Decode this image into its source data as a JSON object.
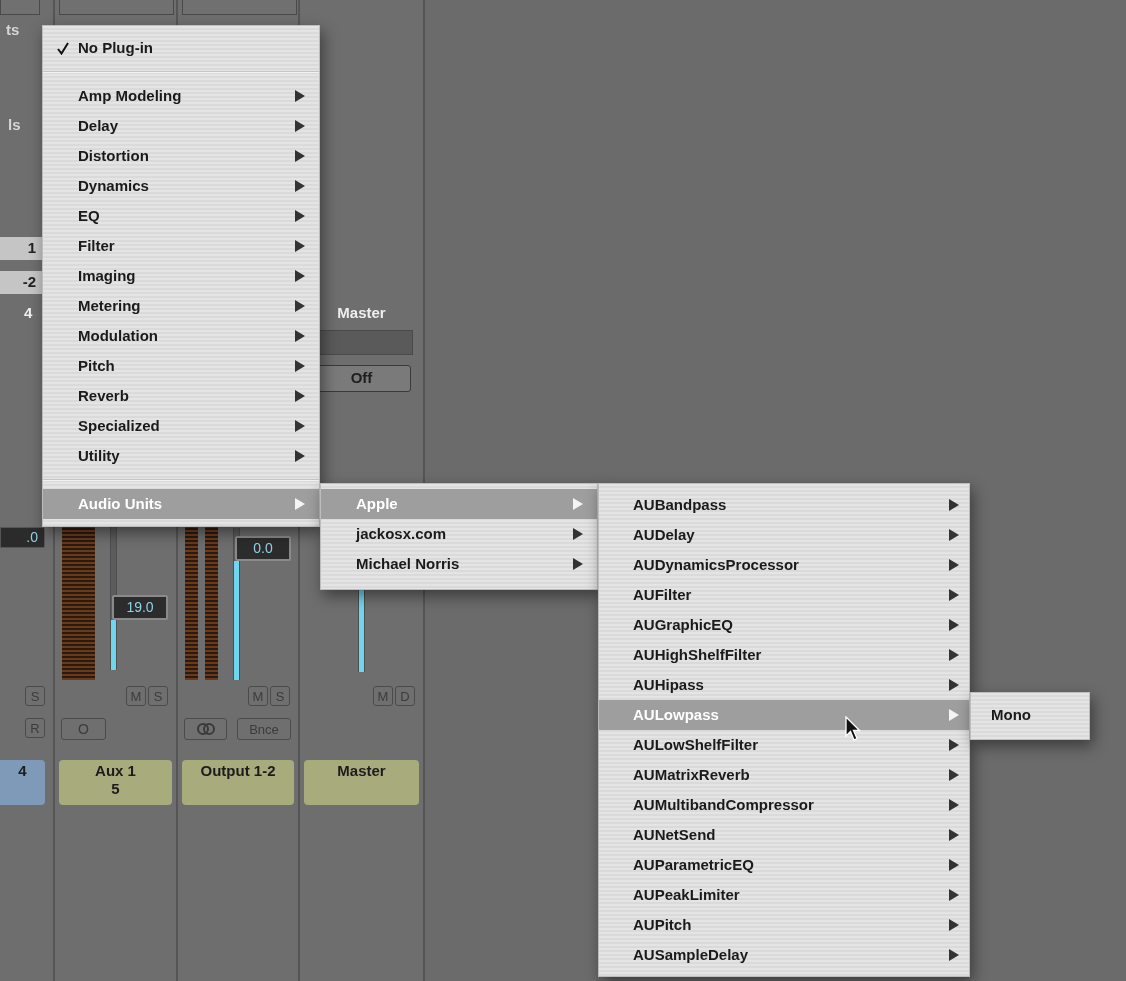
{
  "mixer": {
    "strips": [
      {
        "kind": "cut",
        "inserts_label": "ts",
        "sends_label": "ls",
        "io_buttons": [
          "1",
          "-2"
        ],
        "name": "4",
        "readout": ".0",
        "row_a": [
          {
            "kind": "text",
            "label": "S"
          }
        ],
        "row_b": [
          {
            "kind": "text",
            "label": "R"
          }
        ],
        "label": "4",
        "color": "#7f9ab9"
      },
      {
        "kind": "aux",
        "readout": "19.0",
        "level": 0.33,
        "row_a": [
          {
            "kind": "text",
            "label": "M"
          },
          {
            "kind": "text",
            "label": "S"
          }
        ],
        "row_b": [
          {
            "kind": "text",
            "label": "O"
          }
        ],
        "label": "Aux 1",
        "number": "5",
        "color": "#a8ab7c"
      },
      {
        "kind": "output",
        "readout": "0.0",
        "level": 0.78,
        "row_a": [
          {
            "kind": "text",
            "label": "M"
          },
          {
            "kind": "text",
            "label": "S"
          }
        ],
        "row_b": [
          {
            "kind": "link"
          },
          {
            "kind": "text",
            "label": "Bnce"
          }
        ],
        "label": "Output 1-2",
        "color": "#a8ab7c"
      },
      {
        "kind": "master",
        "name": "Master",
        "mode": "Off",
        "level": 0.95,
        "row_a": [
          {
            "kind": "text",
            "label": "M"
          },
          {
            "kind": "text",
            "label": "D"
          }
        ],
        "label": "Master",
        "color": "#a8ab7c"
      }
    ]
  },
  "menus": [
    {
      "items": [
        {
          "kind": "check",
          "label": "No Plug-in",
          "checked": true
        },
        {
          "kind": "separator"
        },
        {
          "kind": "submenu",
          "label": "Amp Modeling",
          "selected": false
        },
        {
          "kind": "submenu",
          "label": "Delay",
          "selected": false
        },
        {
          "kind": "submenu",
          "label": "Distortion",
          "selected": false
        },
        {
          "kind": "submenu",
          "label": "Dynamics",
          "selected": false
        },
        {
          "kind": "submenu",
          "label": "EQ",
          "selected": false
        },
        {
          "kind": "submenu",
          "label": "Filter",
          "selected": false
        },
        {
          "kind": "submenu",
          "label": "Imaging",
          "selected": false
        },
        {
          "kind": "submenu",
          "label": "Metering",
          "selected": false
        },
        {
          "kind": "submenu",
          "label": "Modulation",
          "selected": false
        },
        {
          "kind": "submenu",
          "label": "Pitch",
          "selected": false
        },
        {
          "kind": "submenu",
          "label": "Reverb",
          "selected": false
        },
        {
          "kind": "submenu",
          "label": "Specialized",
          "selected": false
        },
        {
          "kind": "submenu",
          "label": "Utility",
          "selected": false
        },
        {
          "kind": "separator"
        },
        {
          "kind": "submenu",
          "label": "Audio Units",
          "selected": true
        }
      ]
    },
    {
      "items": [
        {
          "kind": "submenu",
          "label": "Apple",
          "selected": true
        },
        {
          "kind": "submenu",
          "label": "jackosx.com",
          "selected": false
        },
        {
          "kind": "submenu",
          "label": "Michael Norris",
          "selected": false
        }
      ]
    },
    {
      "items": [
        {
          "kind": "submenu",
          "label": "AUBandpass",
          "selected": false
        },
        {
          "kind": "submenu",
          "label": "AUDelay",
          "selected": false
        },
        {
          "kind": "submenu",
          "label": "AUDynamicsProcessor",
          "selected": false
        },
        {
          "kind": "submenu",
          "label": "AUFilter",
          "selected": false
        },
        {
          "kind": "submenu",
          "label": "AUGraphicEQ",
          "selected": false
        },
        {
          "kind": "submenu",
          "label": "AUHighShelfFilter",
          "selected": false
        },
        {
          "kind": "submenu",
          "label": "AUHipass",
          "selected": false
        },
        {
          "kind": "submenu",
          "label": "AULowpass",
          "selected": true
        },
        {
          "kind": "submenu",
          "label": "AULowShelfFilter",
          "selected": false
        },
        {
          "kind": "submenu",
          "label": "AUMatrixReverb",
          "selected": false
        },
        {
          "kind": "submenu",
          "label": "AUMultibandCompressor",
          "selected": false
        },
        {
          "kind": "submenu",
          "label": "AUNetSend",
          "selected": false
        },
        {
          "kind": "submenu",
          "label": "AUParametricEQ",
          "selected": false
        },
        {
          "kind": "submenu",
          "label": "AUPeakLimiter",
          "selected": false
        },
        {
          "kind": "submenu",
          "label": "AUPitch",
          "selected": false
        },
        {
          "kind": "submenu",
          "label": "AUSampleDelay",
          "selected": false
        }
      ]
    },
    {
      "items": [
        {
          "kind": "plain",
          "label": "Mono",
          "selected": false
        }
      ]
    }
  ]
}
